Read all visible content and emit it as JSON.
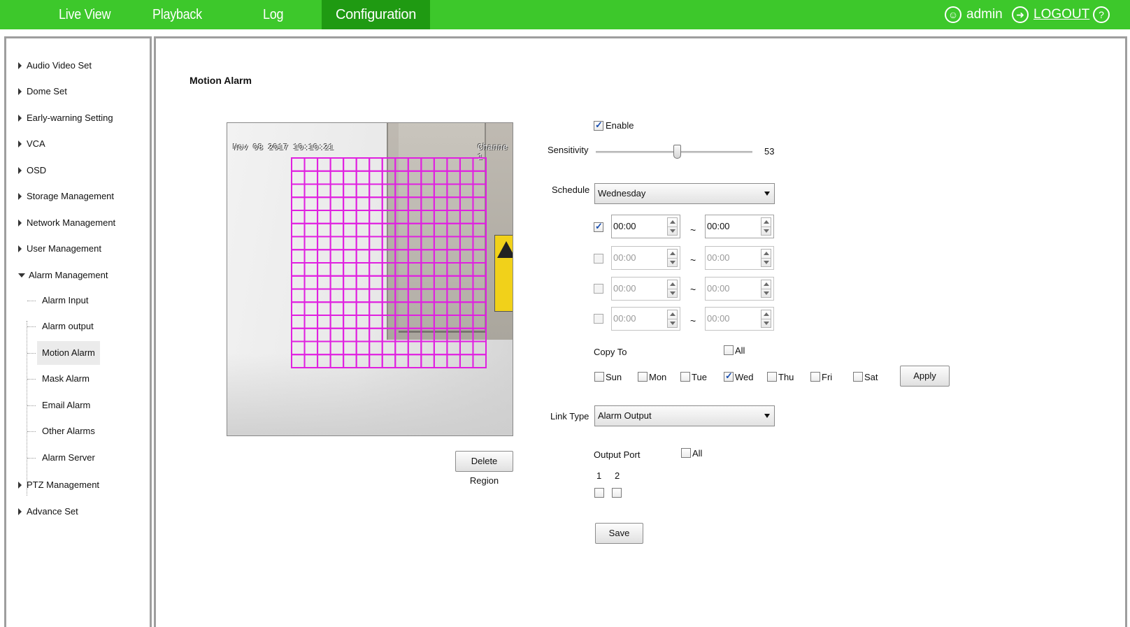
{
  "topbar": {
    "nav": [
      "Live View",
      "Playback",
      "Log",
      "Configuration"
    ],
    "active": "Configuration",
    "user": "admin",
    "logout": "LOGOUT",
    "user_icon": "user-icon",
    "logout_icon": "logout-icon",
    "help_icon": "help-icon",
    "help_glyph": "?",
    "bg_color": "#3dc82b",
    "active_color": "#1f9a12"
  },
  "sidebar": {
    "items": [
      "Audio Video Set",
      "Dome Set",
      "Early-warning Setting",
      "VCA",
      "OSD",
      "Storage Management",
      "Network Management",
      "User Management",
      "Alarm Management",
      "PTZ Management",
      "Advance Set"
    ],
    "alarm_children": [
      "Alarm Input",
      "Alarm output",
      "Motion Alarm",
      "Mask Alarm",
      "Email Alarm",
      "Other Alarms",
      "Alarm Server"
    ],
    "selected": "Motion Alarm"
  },
  "page": {
    "title": "Motion Alarm",
    "video": {
      "osd_datetime": "Nov 08 2017 10:10:21",
      "osd_channel": "Channe 1",
      "grid_color": "#e020e0"
    },
    "delete_region": "Delete Region",
    "enable_label": "Enable",
    "enable_checked": true,
    "sensitivity_label": "Sensitivity",
    "sensitivity_value": "53",
    "schedule_label": "Schedule",
    "schedule_day": "Wednesday",
    "schedule_rows": [
      {
        "checked": true,
        "start": "00:00",
        "end": "00:00",
        "enabled": true
      },
      {
        "checked": false,
        "start": "00:00",
        "end": "00:00",
        "enabled": false
      },
      {
        "checked": false,
        "start": "00:00",
        "end": "00:00",
        "enabled": false
      },
      {
        "checked": false,
        "start": "00:00",
        "end": "00:00",
        "enabled": false
      }
    ],
    "tilde": "~",
    "copy_to_label": "Copy To",
    "all_label": "All",
    "days": [
      {
        "label": "Sun",
        "checked": false
      },
      {
        "label": "Mon",
        "checked": false
      },
      {
        "label": "Tue",
        "checked": false
      },
      {
        "label": "Wed",
        "checked": true
      },
      {
        "label": "Thu",
        "checked": false
      },
      {
        "label": "Fri",
        "checked": false
      },
      {
        "label": "Sat",
        "checked": false
      }
    ],
    "apply": "Apply",
    "link_type_label": "Link Type",
    "link_type_value": "Alarm Output",
    "output_port_label": "Output Port",
    "ports": [
      "1",
      "2"
    ],
    "save": "Save"
  }
}
